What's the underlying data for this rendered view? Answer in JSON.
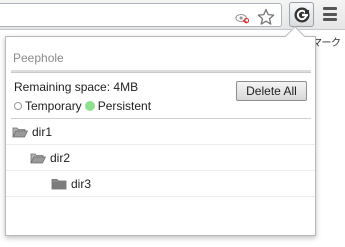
{
  "browser": {
    "tracking_icon": "tracking-eye-icon",
    "bookmark_icon": "star-icon",
    "extension_icon": "peephole-extension-icon",
    "menu_icon": "menu-icon",
    "bookmark_bar_fragment": "マーク"
  },
  "popup": {
    "title": "Peephole",
    "remaining_label": "Remaining space:",
    "remaining_value": "4MB",
    "delete_all_label": "Delete All",
    "storage_types": [
      {
        "label": "Temporary",
        "selected": false
      },
      {
        "label": "Persistent",
        "selected": true
      }
    ],
    "tree": [
      {
        "name": "dir1",
        "open": true,
        "level": 0
      },
      {
        "name": "dir2",
        "open": true,
        "level": 1
      },
      {
        "name": "dir3",
        "open": false,
        "level": 2
      }
    ]
  },
  "colors": {
    "persistent_indicator": "#8fe08f",
    "title_text": "#8b8b8b",
    "folder": "#8a8a8a"
  }
}
